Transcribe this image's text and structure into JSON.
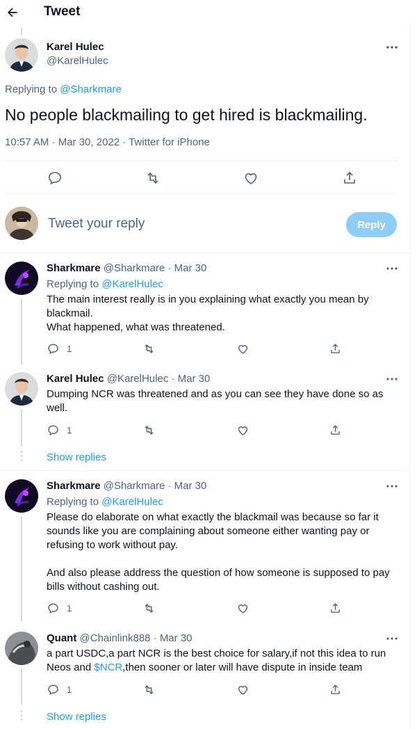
{
  "header": {
    "title": "Tweet"
  },
  "main_tweet": {
    "name": "Karel Hulec",
    "handle": "@KarelHulec",
    "replying_prefix": "Replying to ",
    "replying_to": "@Sharkmare",
    "text": "No people blackmailing to get hired is blackmailing.",
    "meta": "10:57 AM · Mar 30, 2022 · Twitter for iPhone"
  },
  "composer": {
    "placeholder": "Tweet your reply",
    "reply_label": "Reply"
  },
  "replies": [
    {
      "name": "Sharkmare",
      "handle": "@Sharkmare",
      "sep": " · ",
      "date": "Mar 30",
      "replying_prefix": "Replying to ",
      "replying_to": "@KarelHulec",
      "line1": "The main interest really is in you explaining what exactly you mean by",
      "line2": "blackmail.",
      "line3": "What happened, what was threatened.",
      "reply_count": "1"
    },
    {
      "name": "Karel Hulec",
      "handle": "@KarelHulec",
      "sep": " · ",
      "date": "Mar 30",
      "line1": "Dumping NCR was threatened and as you can see they have done so as",
      "line2": "well.",
      "reply_count": "1",
      "show_replies": "Show replies"
    },
    {
      "name": "Sharkmare",
      "handle": "@Sharkmare",
      "sep": " · ",
      "date": "Mar 30",
      "replying_prefix": "Replying to ",
      "replying_to": "@KarelHulec",
      "line1": "Please do elaborate on what exactly the blackmail was because so far it",
      "line2": "sounds like you are complaining about someone either wanting pay or",
      "line3": "refusing to work without pay.",
      "line4": "And also please address the question of how someone is supposed to pay",
      "line5": "bills without cashing out.",
      "reply_count": "1"
    },
    {
      "name": "Quant",
      "handle": "@Chainlink888",
      "sep": " · ",
      "date": "Mar 30",
      "line1": "a part USDC,a part NCR is the best choice for salary,if not this idea to run",
      "line2_pre": "Neos and ",
      "line2_link": "$NCR",
      "line2_post": ",then sooner or later will have dispute in inside team",
      "reply_count": "1",
      "show_replies": "Show replies"
    }
  ],
  "colors": {
    "accent": "#1d9bf0",
    "text": "#0f1419",
    "muted": "#536471",
    "reply_btn": "#8ecdf8"
  }
}
